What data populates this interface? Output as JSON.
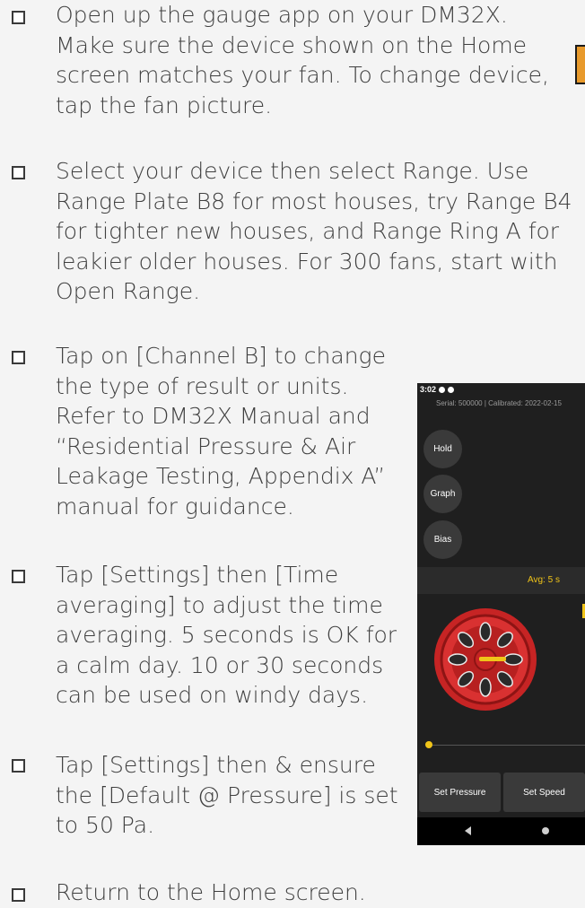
{
  "checklist": [
    {
      "lines": [
        "Open up the gauge app on your DM32X.",
        "Make sure the device shown on the Home",
        "screen matches your fan. To change device,",
        "tap the fan picture."
      ]
    },
    {
      "lines": [
        "Select your device then select Range. Use",
        "Range Plate B8 for most houses, try Range B4",
        "for tighter new houses, and Range Ring A for",
        "leakier older houses. For 300 fans, start with",
        "Open Range."
      ]
    },
    {
      "lines": [
        "Tap on [Channel B] to change",
        "the type of result or units.",
        "Refer to DM32X Manual and",
        "“Residential Pressure & Air",
        "Leakage Testing, Appendix A”",
        "manual for guidance."
      ]
    },
    {
      "lines": [
        "Tap [Settings] then [Time",
        "averaging] to adjust the time",
        "averaging. 5 seconds is OK for",
        "a calm day. 10 or 30 seconds",
        "can be used on windy days."
      ]
    },
    {
      "lines": [
        "Tap [Settings] then & ensure",
        "the [Default @ Pressure] is set",
        "to 50 Pa."
      ]
    },
    {
      "lines": [
        "Return to the Home screen."
      ]
    }
  ],
  "phone": {
    "status_time": "3:02",
    "serial_text": "Serial: 500000 | Calibrated: 2022-02-15",
    "hold_label": "Hold",
    "graph_label": "Graph",
    "bias_label": "Bias",
    "averaging_label": "Avg: 5 s",
    "set_pressure_label": "Set Pressure",
    "set_speed_label": "Set Speed",
    "nav_icons": [
      "back-icon",
      "home-icon"
    ]
  },
  "colors": {
    "accent": "#f0c419",
    "fan_red": "#d42a2a",
    "phone_bg": "#1f1f1f",
    "page_bg": "#f4f4f4"
  }
}
